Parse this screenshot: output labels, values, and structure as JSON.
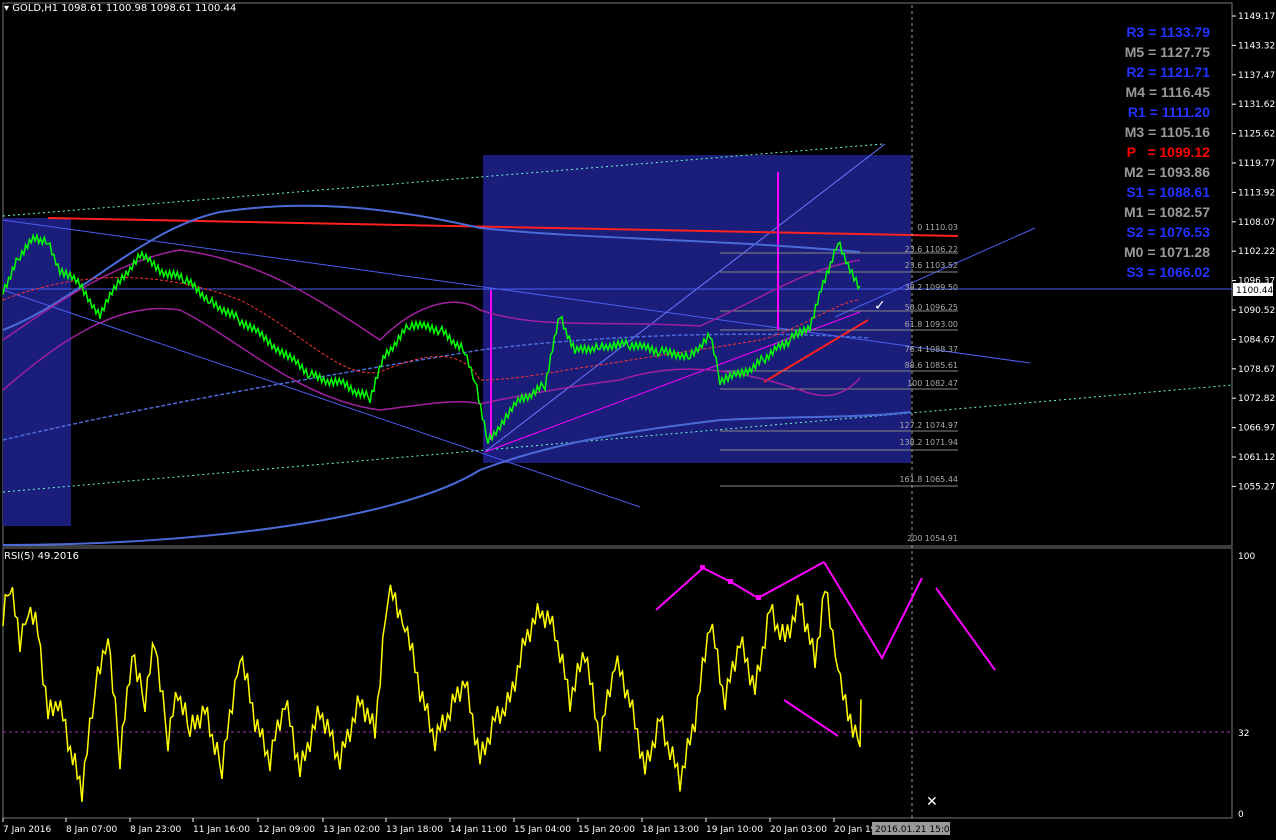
{
  "window": {
    "symbol_label": "GOLD,H1  1098.61 1100.98 1098.61 1100.44",
    "menu_icon": "triangle-down-icon"
  },
  "colors": {
    "background": "#000000",
    "price_up": "#00ff00",
    "rsi_line": "#ffff00",
    "box_fill": "#1b1d7a",
    "support_blue": "#2233ff",
    "pivot_main": "#ff0000",
    "mid_gray": "#9a9a9a",
    "magenta": "#ff00ff"
  },
  "price_axis": {
    "ticks": [
      "1149.17",
      "1143.32",
      "1137.47",
      "1131.62",
      "1125.62",
      "1119.77",
      "1113.92",
      "1108.07",
      "1102.22",
      "1096.37",
      "1090.52",
      "1084.67",
      "1078.67",
      "1072.82",
      "1066.97",
      "1061.12",
      "1055.27"
    ],
    "current_price": "1100.44"
  },
  "time_axis": {
    "ticks": [
      "7 Jan 2016",
      "8 Jan 07:00",
      "8 Jan 23:00",
      "11 Jan 16:00",
      "12 Jan 09:00",
      "13 Jan 02:00",
      "13 Jan 18:00",
      "14 Jan 11:00",
      "15 Jan 04:00",
      "15 Jan 20:00",
      "18 Jan 13:00",
      "19 Jan 10:00",
      "20 Jan 03:00",
      "20 Jan 19"
    ],
    "crosshair_time": "2016.01.21 15:00"
  },
  "pivots": [
    {
      "label": "R3 = 1133.79",
      "color": "#2233ff"
    },
    {
      "label": "M5 = 1127.75",
      "color": "#9a9a9a"
    },
    {
      "label": "R2 = 1121.71",
      "color": "#2233ff"
    },
    {
      "label": "M4 = 1116.45",
      "color": "#9a9a9a"
    },
    {
      "label": "R1 = 1111.20",
      "color": "#2233ff"
    },
    {
      "label": "M3 = 1105.16",
      "color": "#9a9a9a"
    },
    {
      "label": "P   = 1099.12",
      "color": "#ff0000"
    },
    {
      "label": "M2 = 1093.86",
      "color": "#9a9a9a"
    },
    {
      "label": "S1 = 1088.61",
      "color": "#2233ff"
    },
    {
      "label": "M1 = 1082.57",
      "color": "#9a9a9a"
    },
    {
      "label": "S2 = 1076.53",
      "color": "#2233ff"
    },
    {
      "label": "M0 = 1071.28",
      "color": "#9a9a9a"
    },
    {
      "label": "S3 = 1066.02",
      "color": "#2233ff"
    }
  ],
  "fib_levels": [
    "0 1110.03",
    "23.6 1106.22",
    "23.6 1103.52",
    "38.2 1099.50",
    "50.0 1096.25",
    "61.8 1093.00",
    "76.4 1088.37",
    "88.6 1085.61",
    "100 1082.47",
    "127.2 1074.97",
    "138.2 1071.94",
    "161.8 1065.44",
    "200 1054.91"
  ],
  "rsi": {
    "label": "RSI(5) 49.2016",
    "ticks": [
      "100",
      "32",
      "0"
    ]
  },
  "markers": {
    "check_icon": "check-icon",
    "close_icon": "x-icon"
  }
}
